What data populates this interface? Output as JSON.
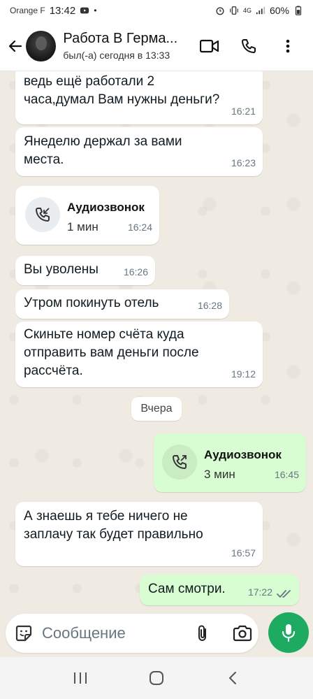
{
  "status_bar": {
    "carrier": "Orange F",
    "time": "13:42",
    "network": "4G",
    "battery": "60%"
  },
  "header": {
    "title": "Работа В Герма...",
    "subtitle": "был(-а) сегодня в 13:33",
    "icons": [
      "back-arrow-icon",
      "video-call-icon",
      "phone-icon",
      "more-vert-icon"
    ]
  },
  "messages": [
    {
      "type": "text",
      "direction": "in",
      "text_lines": [
        "ведь ещё работали 2",
        "часа,думал Вам нужны деньги?"
      ],
      "time": "16:21"
    },
    {
      "type": "text",
      "direction": "in",
      "text_lines": [
        "Янеделю держал за  вами",
        "места."
      ],
      "time": "16:23"
    },
    {
      "type": "call",
      "direction": "in",
      "title": "Аудиозвонок",
      "duration": "1 мин",
      "time": "16:24"
    },
    {
      "type": "text",
      "direction": "in",
      "text_lines": [
        "Вы уволены"
      ],
      "time": "16:26"
    },
    {
      "type": "text",
      "direction": "in",
      "text_lines": [
        "Утром покинуть отель"
      ],
      "time": "16:28"
    },
    {
      "type": "text",
      "direction": "in",
      "text_lines": [
        "Скиньте номер счёта куда",
        "отправить вам деньги после",
        "рассчёта."
      ],
      "time": "19:12"
    },
    {
      "type": "date",
      "text": "Вчера"
    },
    {
      "type": "call",
      "direction": "out",
      "title": "Аудиозвонок",
      "duration": "3 мин",
      "time": "16:45"
    },
    {
      "type": "text",
      "direction": "in",
      "text_lines": [
        "А знаешь я тебе ничего не",
        "заплачу так будет правильно"
      ],
      "time": "16:57"
    },
    {
      "type": "text",
      "direction": "out",
      "text_lines": [
        "Сам смотри."
      ],
      "time": "17:22",
      "status": "read"
    }
  ],
  "composer": {
    "placeholder": "Сообщение"
  },
  "colors": {
    "chat_bg": "#efeae2",
    "incoming": "#ffffff",
    "outgoing": "#d9fdd3",
    "accent": "#1daa61",
    "read_ticks": "#667781"
  }
}
